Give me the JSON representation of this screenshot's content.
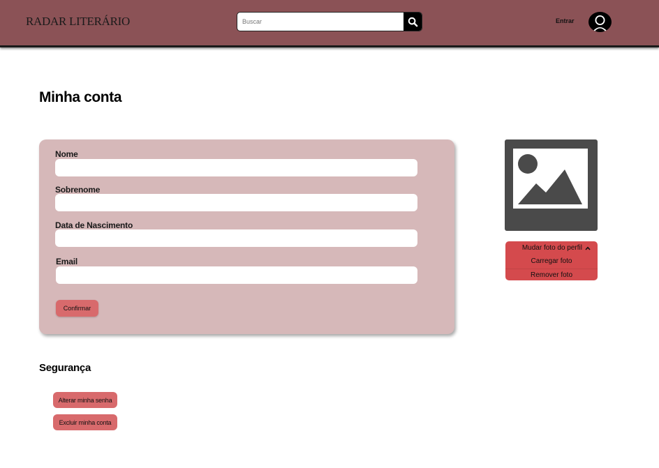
{
  "header": {
    "logo": "RADAR LITERÁRIO",
    "search_placeholder": "Buscar",
    "login_label": "Entrar"
  },
  "page": {
    "title": "Minha conta"
  },
  "form": {
    "fields": [
      {
        "label": "Nome",
        "value": ""
      },
      {
        "label": "Sobrenome",
        "value": ""
      },
      {
        "label": "Data de Nascimento",
        "value": ""
      },
      {
        "label": "Email",
        "value": ""
      }
    ],
    "confirm_label": "Confirmar"
  },
  "profile_photo": {
    "menu_title": "Mudar foto do perfil",
    "upload_label": "Carregar foto",
    "remove_label": "Remover foto"
  },
  "security": {
    "title": "Segurança",
    "change_password_label": "Alterar minha senha",
    "delete_account_label": "Excluir minha conta"
  },
  "colors": {
    "header_bg": "#8b5256",
    "card_bg": "#d6b8b9",
    "button_bg": "#d86a6c",
    "photo_menu_bg": "#d44a4d"
  },
  "icons": {
    "search": "search-icon",
    "avatar": "user-avatar-icon",
    "photo_placeholder": "image-placeholder-icon",
    "chevron": "chevron-up-icon"
  }
}
